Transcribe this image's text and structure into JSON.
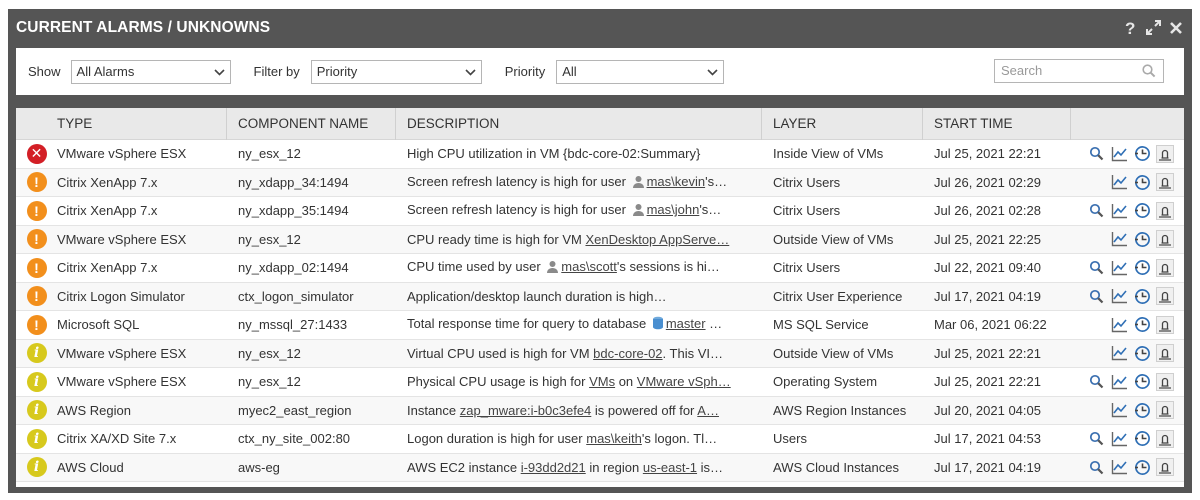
{
  "header": {
    "title": "CURRENT ALARMS / UNKNOWNS"
  },
  "filters": {
    "show_label": "Show",
    "show_value": "All Alarms",
    "filter_label": "Filter by",
    "filter_value": "Priority",
    "priority_label": "Priority",
    "priority_value": "All",
    "search_placeholder": "Search"
  },
  "columns": [
    "TYPE",
    "COMPONENT NAME",
    "DESCRIPTION",
    "LAYER",
    "START TIME"
  ],
  "rows": [
    {
      "severity": "critical",
      "type": "VMware vSphere ESX",
      "component": "ny_esx_12",
      "desc": [
        {
          "t": "High CPU utilization in VM {bdc-core-02:Summary}"
        }
      ],
      "layer": "Inside View of VMs",
      "time": "Jul 25, 2021 22:21",
      "search": true
    },
    {
      "severity": "major",
      "type": "Citrix XenApp 7.x",
      "component": "ny_xdapp_34:1494",
      "desc": [
        {
          "t": "Screen refresh latency is high for user "
        },
        {
          "t": "user-icon",
          "icon": "user"
        },
        {
          "t": "mas\\kevin",
          "link": true
        },
        {
          "t": "'s…"
        }
      ],
      "layer": "Citrix Users",
      "time": "Jul 26, 2021 02:29",
      "search": false
    },
    {
      "severity": "major",
      "type": "Citrix XenApp 7.x",
      "component": "ny_xdapp_35:1494",
      "desc": [
        {
          "t": "Screen refresh latency is high for user "
        },
        {
          "t": "user-icon",
          "icon": "user"
        },
        {
          "t": "mas\\john",
          "link": true
        },
        {
          "t": "'s…"
        }
      ],
      "layer": "Citrix Users",
      "time": "Jul 26, 2021 02:28",
      "search": true
    },
    {
      "severity": "major",
      "type": "VMware vSphere ESX",
      "component": "ny_esx_12",
      "desc": [
        {
          "t": "CPU ready time is high for VM "
        },
        {
          "t": "XenDesktop AppServe…",
          "link": true
        }
      ],
      "layer": "Outside View of VMs",
      "time": "Jul 25, 2021 22:25",
      "search": false
    },
    {
      "severity": "major",
      "type": "Citrix XenApp 7.x",
      "component": "ny_xdapp_02:1494",
      "desc": [
        {
          "t": "CPU time used by user "
        },
        {
          "t": "user-icon",
          "icon": "user"
        },
        {
          "t": "mas\\scott",
          "link": true
        },
        {
          "t": "'s sessions is hi…"
        }
      ],
      "layer": "Citrix Users",
      "time": "Jul 22, 2021 09:40",
      "search": true
    },
    {
      "severity": "major",
      "type": "Citrix Logon Simulator",
      "component": "ctx_logon_simulator",
      "desc": [
        {
          "t": "Application/desktop launch duration is high…"
        }
      ],
      "layer": "Citrix User Experience",
      "time": "Jul 17, 2021 04:19",
      "search": true
    },
    {
      "severity": "major",
      "type": "Microsoft SQL",
      "component": "ny_mssql_27:1433",
      "desc": [
        {
          "t": "Total response time for query to database "
        },
        {
          "t": "database-icon",
          "icon": "db"
        },
        {
          "t": "master",
          "link": true
        },
        {
          "t": " …"
        }
      ],
      "layer": "MS SQL Service",
      "time": "Mar 06, 2021 06:22",
      "search": false
    },
    {
      "severity": "minor",
      "type": "VMware vSphere ESX",
      "component": "ny_esx_12",
      "desc": [
        {
          "t": "Virtual CPU used is high for VM "
        },
        {
          "t": "bdc-core-02",
          "link": true
        },
        {
          "t": ". This VI…"
        }
      ],
      "layer": "Outside View of VMs",
      "time": "Jul 25, 2021 22:21",
      "search": false
    },
    {
      "severity": "minor",
      "type": "VMware vSphere ESX",
      "component": "ny_esx_12",
      "desc": [
        {
          "t": "Physical CPU usage is high for "
        },
        {
          "t": "VMs",
          "link": true
        },
        {
          "t": " on "
        },
        {
          "t": "VMware vSph…",
          "link": true
        }
      ],
      "layer": "Operating System",
      "time": "Jul 25, 2021 22:21",
      "search": true
    },
    {
      "severity": "minor",
      "type": "AWS Region",
      "component": "myec2_east_region",
      "desc": [
        {
          "t": "Instance "
        },
        {
          "t": "zap_mware:i-b0c3efe4",
          "link": true
        },
        {
          "t": " is powered off for "
        },
        {
          "t": "A…",
          "link": true
        }
      ],
      "layer": "AWS Region Instances",
      "time": "Jul 20, 2021 04:05",
      "search": false
    },
    {
      "severity": "minor",
      "type": "Citrix XA/XD Site 7.x",
      "component": "ctx_ny_site_002:80",
      "desc": [
        {
          "t": "Logon duration is high for user "
        },
        {
          "t": "mas\\keith",
          "link": true
        },
        {
          "t": "'s logon. Tl…"
        }
      ],
      "layer": "Users",
      "time": "Jul 17, 2021 04:53",
      "search": true
    },
    {
      "severity": "minor",
      "type": "AWS Cloud",
      "component": "aws-eg",
      "desc": [
        {
          "t": "AWS EC2 instance "
        },
        {
          "t": "i-93dd2d21",
          "link": true
        },
        {
          "t": " in region "
        },
        {
          "t": "us-east-1",
          "link": true
        },
        {
          "t": " is…"
        }
      ],
      "layer": "AWS Cloud Instances",
      "time": "Jul 17, 2021 04:19",
      "search": true
    }
  ],
  "icons": {
    "header": [
      "help-icon",
      "expand-icon",
      "close-icon"
    ],
    "row_actions": [
      "search-icon",
      "graph-icon",
      "history-icon",
      "alarm-bell-icon"
    ]
  },
  "colors": {
    "critical": "#d31f26",
    "major": "#f28f1c",
    "minor": "#d7c91d",
    "titlebar": "#555555"
  }
}
